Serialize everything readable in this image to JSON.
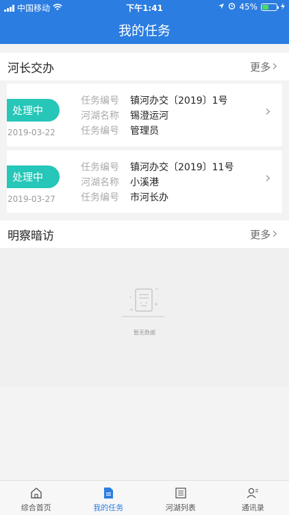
{
  "status_bar": {
    "carrier": "中国移动",
    "time": "下午1:41",
    "battery": "45%",
    "battery_level": 0.45
  },
  "header": {
    "title": "我的任务"
  },
  "section_river": {
    "title": "河长交办",
    "more": "更多"
  },
  "tasks": [
    {
      "status": "处理中",
      "date": "2019-03-22",
      "rows": [
        {
          "label": "任务编号",
          "value": "镇河办交〔2019〕1号"
        },
        {
          "label": "河湖名称",
          "value": "锡澄运河"
        },
        {
          "label": "任务编号",
          "value": "管理员"
        }
      ]
    },
    {
      "status": "处理中",
      "date": "2019-03-27",
      "rows": [
        {
          "label": "任务编号",
          "value": "镇河办交〔2019〕11号"
        },
        {
          "label": "河湖名称",
          "value": "小溪港"
        },
        {
          "label": "任务编号",
          "value": "市河长办"
        }
      ]
    }
  ],
  "section_inspect": {
    "title": "明察暗访",
    "more": "更多",
    "empty_text": "暂无数据"
  },
  "tabbar": {
    "items": [
      {
        "label": "综合首页",
        "icon": "home-icon",
        "active": false
      },
      {
        "label": "我的任务",
        "icon": "document-icon",
        "active": true
      },
      {
        "label": "河湖列表",
        "icon": "list-icon",
        "active": false
      },
      {
        "label": "通讯录",
        "icon": "contacts-icon",
        "active": false
      }
    ]
  },
  "colors": {
    "primary": "#2b7de1",
    "badge": "#26c6b8"
  }
}
